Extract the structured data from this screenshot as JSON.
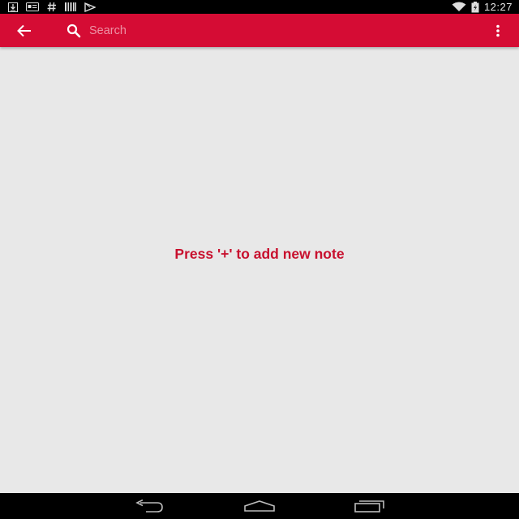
{
  "status_bar": {
    "time": "12:27",
    "left_icons": [
      "download-icon",
      "news-icon",
      "hashtag-icon",
      "barcode-icon",
      "play-store-icon"
    ],
    "right_icons": [
      "wifi-icon",
      "battery-icon"
    ]
  },
  "toolbar": {
    "back_icon": "arrow-back-icon",
    "search_placeholder": "Search",
    "search_value": "",
    "overflow_icon": "more-vert-icon",
    "color": "#d50c34"
  },
  "content": {
    "empty_message": "Press '+' to add new note",
    "background": "#e8e8e8",
    "message_color": "#c8102e"
  },
  "nav_bar": {
    "buttons": [
      "back-nav-icon",
      "home-nav-icon",
      "recents-nav-icon"
    ]
  }
}
